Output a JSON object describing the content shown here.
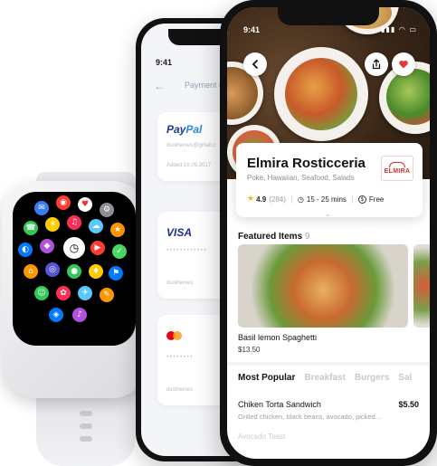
{
  "status_bar": {
    "time": "9:41"
  },
  "payment_screen": {
    "title": "Payment m",
    "methods": [
      {
        "brand": "PayPal",
        "email": "dsothemes@gmail.c",
        "date": "Added 18.09.2017"
      },
      {
        "brand": "VISA",
        "masked": "• • • •   • • • •   • • • •",
        "holder": "dsothemes"
      },
      {
        "brand": "mastercard",
        "masked": "• • • •   • • • •",
        "holder": "dsothemes"
      }
    ]
  },
  "restaurant": {
    "name": "Elmira Rosticceria",
    "tags": "Poke, Hawaiian, Seafood, Salads",
    "logo_text": "ELMIRA",
    "rating": "4.9",
    "reviews": "(284)",
    "delivery_time": "15 - 25 mins",
    "delivery_fee": "Free"
  },
  "featured": {
    "title": "Featured Items",
    "count": "9",
    "items": [
      {
        "name": "Basil lemon Spaghetti",
        "price": "$13.50"
      }
    ]
  },
  "menu_tabs": [
    "Most Popular",
    "Breakfast",
    "Burgers",
    "Sal"
  ],
  "menu_items": [
    {
      "name": "Chiken Torta Sandwich",
      "price": "$5.50",
      "desc": "Grilled chicken, black beans, avocado, picked..."
    },
    {
      "name": "Avocado Toast",
      "price": "",
      "desc": ""
    }
  ],
  "icons": {
    "back": "chevron-left-icon",
    "share": "share-icon",
    "favorite": "heart-icon",
    "rating": "star-icon",
    "delivery_time": "clock-icon",
    "delivery": "dollar-icon"
  },
  "colors": {
    "accent_red": "#e53935",
    "rating_yellow": "#f5b21b"
  }
}
